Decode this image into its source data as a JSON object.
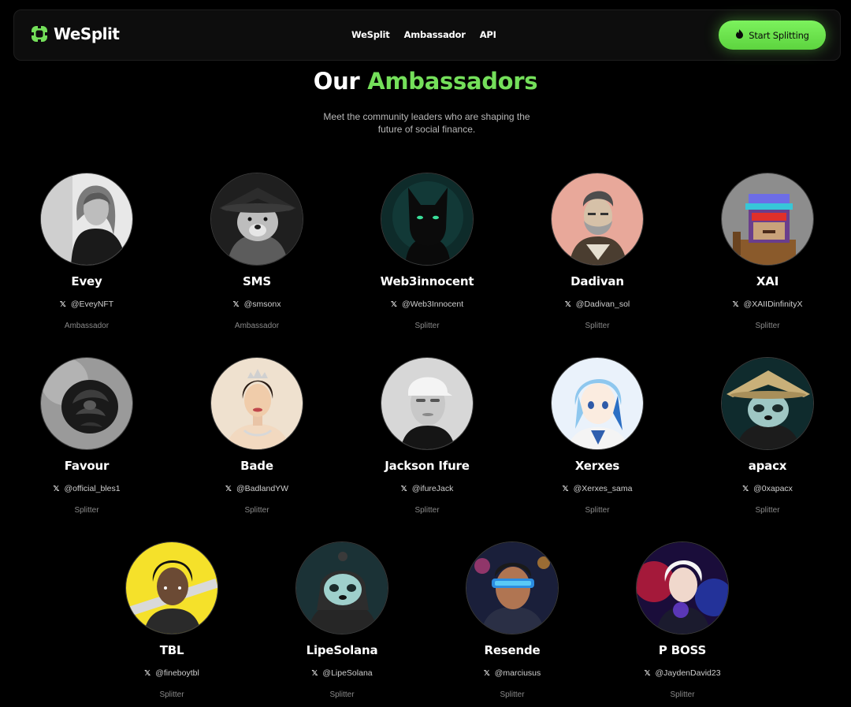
{
  "brand": {
    "name": "WeSplit",
    "accent_color": "#74df5a"
  },
  "nav": {
    "links": [
      "WeSplit",
      "Ambassador",
      "API"
    ]
  },
  "cta": {
    "label": "Start Splitting",
    "icon": "flame-icon"
  },
  "hero": {
    "title_prefix": "Our",
    "title_accent": "Ambassadors",
    "subtitle": "Meet the community leaders who are shaping the future of social finance."
  },
  "ambassadors": [
    {
      "name": "Evey",
      "handle": "@EveyNFT",
      "role": "Ambassador",
      "avatar": "woman-portrait"
    },
    {
      "name": "SMS",
      "handle": "@smsonx",
      "role": "Ambassador",
      "avatar": "bear-with-hat"
    },
    {
      "name": "Web3innocent",
      "handle": "@Web3Innocent",
      "role": "Splitter",
      "avatar": "black-cat"
    },
    {
      "name": "Dadivan",
      "handle": "@Dadivan_sol",
      "role": "Splitter",
      "avatar": "bearded-man-sketch"
    },
    {
      "name": "XAI",
      "handle": "@XAIIDinfinityX",
      "role": "Splitter",
      "avatar": "pixel-ape"
    },
    {
      "name": "Favour",
      "handle": "@official_bles1",
      "role": "Splitter",
      "avatar": "black-rose"
    },
    {
      "name": "Bade",
      "handle": "@BadlandYW",
      "role": "Splitter",
      "avatar": "woman-with-tiara"
    },
    {
      "name": "Jackson Ifure",
      "handle": "@ifureJack",
      "role": "Splitter",
      "avatar": "white-cap-character"
    },
    {
      "name": "Xerxes",
      "handle": "@Xerxes_sama",
      "role": "Splitter",
      "avatar": "anime-character"
    },
    {
      "name": "apacx",
      "handle": "@0xapacx",
      "role": "Splitter",
      "avatar": "panda-with-hat"
    },
    {
      "name": "TBL",
      "handle": "@fineboytbl",
      "role": "Splitter",
      "avatar": "cartoon-boy"
    },
    {
      "name": "LipeSolana",
      "handle": "@LipeSolana",
      "role": "Splitter",
      "avatar": "panda-hoodie"
    },
    {
      "name": "Resende",
      "handle": "@marciusus",
      "role": "Splitter",
      "avatar": "cyber-visor-man"
    },
    {
      "name": "P BOSS",
      "handle": "@JaydenDavid23",
      "role": "Splitter",
      "avatar": "anime-neon"
    }
  ],
  "icons": {
    "social": "x-icon"
  }
}
